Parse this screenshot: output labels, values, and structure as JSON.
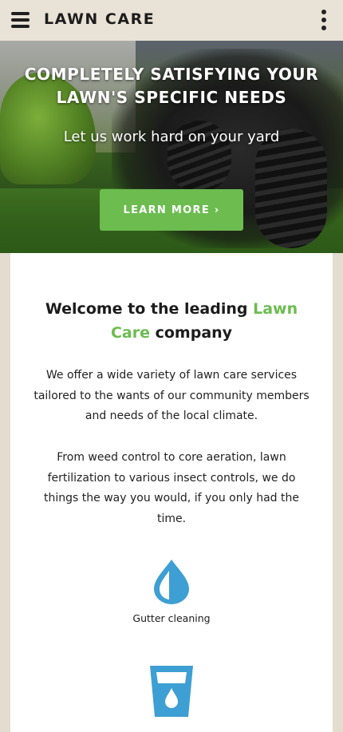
{
  "header": {
    "menu_icon": "hamburger-menu-icon",
    "brand": "LAWN CARE",
    "more_icon": "vertical-dots-icon"
  },
  "hero": {
    "title_line1": "COMPLETELY SATISFYING YOUR",
    "title_line2": "LAWN'S SPECIFIC NEEDS",
    "subtitle": "Let us work hard on your yard",
    "cta_label": "LEARN MORE ›"
  },
  "welcome": {
    "prefix": "Welcome to the leading ",
    "highlight_line1": "Lawn",
    "highlight_line2": "Care",
    "suffix": " company",
    "paragraph1": "We offer a wide variety of lawn care services tailored to the wants of our community members and needs of the local climate.",
    "paragraph2": "From weed control to core aeration, lawn fertilization to various insect controls, we do things the way you would, if you only had the time."
  },
  "services": [
    {
      "icon": "water-drop-icon",
      "label": "Gutter cleaning"
    },
    {
      "icon": "water-glass-icon",
      "label": ""
    }
  ],
  "colors": {
    "accent_green": "#6cbc4f",
    "icon_blue": "#3d9fd3",
    "page_background": "#e3dccf"
  }
}
